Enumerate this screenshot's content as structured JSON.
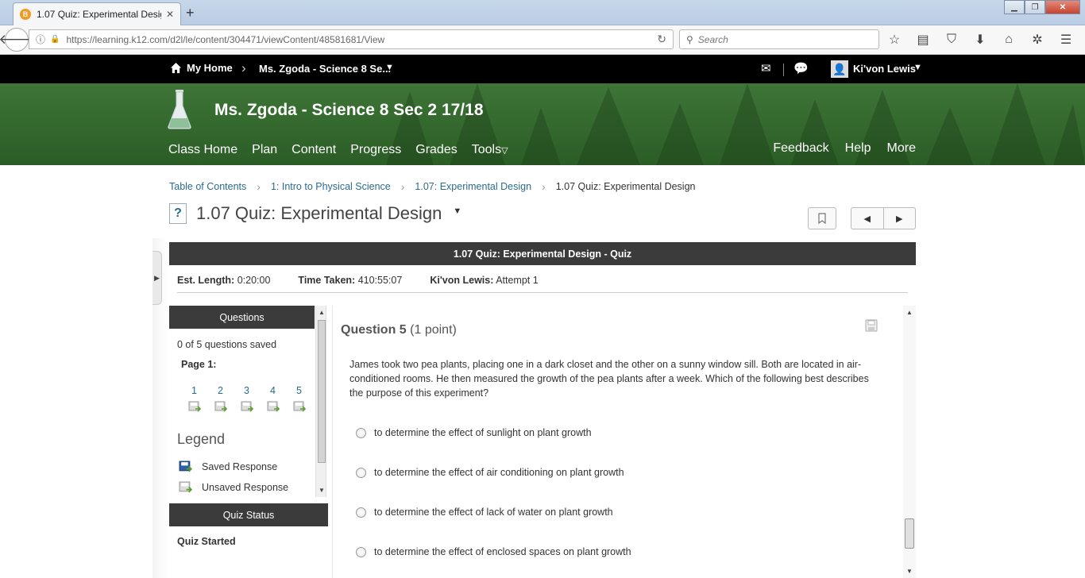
{
  "browser": {
    "tab_title": "1.07 Quiz: Experimental Desig",
    "tab_favicon": "B",
    "url": "https://learning.k12.com/d2l/le/content/304471/viewContent/48581681/View",
    "search_placeholder": "Search"
  },
  "minibar": {
    "home": "My Home",
    "course": "Ms. Zgoda - Science 8 Se...",
    "user": "Ki'von Lewis"
  },
  "banner": {
    "course_title": "Ms. Zgoda - Science 8 Sec 2 17/18",
    "nav": [
      "Class Home",
      "Plan",
      "Content",
      "Progress",
      "Grades",
      "Tools"
    ],
    "nav_right": [
      "Feedback",
      "Help",
      "More"
    ]
  },
  "breadcrumbs": [
    "Table of Contents",
    "1: Intro to Physical Science",
    "1.07: Experimental Design"
  ],
  "breadcrumb_current": "1.07 Quiz: Experimental Design",
  "page_title": "1.07 Quiz: Experimental Design",
  "quiz": {
    "header": "1.07 Quiz: Experimental Design - Quiz",
    "est_length_label": "Est. Length:",
    "est_length": "0:20:00",
    "time_taken_label": "Time Taken:",
    "time_taken": "410:55:07",
    "student_label": "Ki'von Lewis:",
    "attempt": "Attempt 1"
  },
  "questions_panel": {
    "title": "Questions",
    "saved_count": "0 of 5 questions saved",
    "page_label": "Page 1:",
    "numbers": [
      "1",
      "2",
      "3",
      "4",
      "5"
    ],
    "legend_title": "Legend",
    "legend_saved": "Saved Response",
    "legend_unsaved": "Unsaved Response"
  },
  "status_panel": {
    "title": "Quiz Status",
    "status": "Quiz Started"
  },
  "question": {
    "label": "Question 5",
    "points": "(1 point)",
    "text": "James took two pea plants, placing one in a dark closet and the other on a sunny window sill. Both are located in air-conditioned rooms. He then measured the growth of the pea plants after a week. Which of the following best describes the purpose of this experiment?",
    "options": [
      "to determine the effect of sunlight on plant growth",
      "to determine the effect of air conditioning on plant growth",
      "to determine the effect of lack of water on plant growth",
      "to determine the effect of enclosed spaces on plant growth"
    ]
  },
  "colors": {
    "banner_green": "#2f6329",
    "header_dark": "#3b3b3b",
    "link_blue": "#2a6b8f",
    "notification_red": "#e2261c"
  }
}
